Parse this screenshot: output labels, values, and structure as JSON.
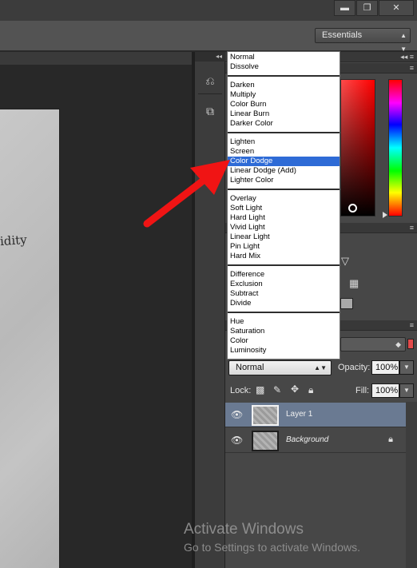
{
  "window": {
    "minimize": "▬",
    "restore": "❐",
    "close": "✕"
  },
  "workspace": {
    "value": "Essentials"
  },
  "document": {
    "visible_text": "idity"
  },
  "blend_menu": {
    "groups": [
      [
        "Normal",
        "Dissolve"
      ],
      [
        "Darken",
        "Multiply",
        "Color Burn",
        "Linear Burn",
        "Darker Color"
      ],
      [
        "Lighten",
        "Screen",
        "Color Dodge",
        "Linear Dodge (Add)",
        "Lighter Color"
      ],
      [
        "Overlay",
        "Soft Light",
        "Hard Light",
        "Vivid Light",
        "Linear Light",
        "Pin Light",
        "Hard Mix"
      ],
      [
        "Difference",
        "Exclusion",
        "Subtract",
        "Divide"
      ],
      [
        "Hue",
        "Saturation",
        "Color",
        "Luminosity"
      ]
    ],
    "highlighted": "Color Dodge"
  },
  "layers_panel": {
    "blend_mode": "Normal",
    "opacity_label": "Opacity:",
    "opacity_value": "100%",
    "lock_label": "Lock:",
    "fill_label": "Fill:",
    "fill_value": "100%",
    "layers": [
      {
        "name": "Layer 1",
        "selected": true,
        "locked": false
      },
      {
        "name": "Background",
        "selected": false,
        "locked": true
      }
    ]
  },
  "annotation": {
    "arrow_color": "#f01414",
    "points_to": "Color Dodge"
  },
  "watermark": {
    "title": "Activate Windows",
    "subtitle": "Go to Settings to activate Windows."
  }
}
